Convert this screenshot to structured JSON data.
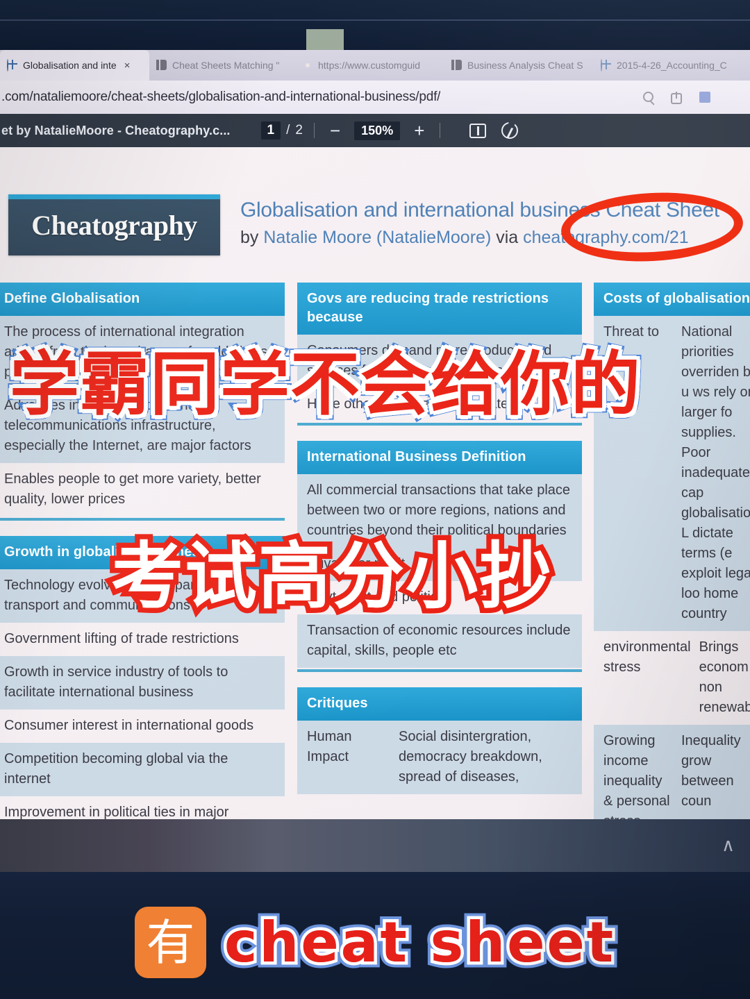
{
  "browser": {
    "tabs": [
      {
        "favicon": "globe-icon",
        "label": "Globalisation and inte",
        "active": true,
        "close": "×"
      },
      {
        "favicon": "book-icon",
        "label": "Cheat Sheets Matching \"",
        "active": false,
        "close": ""
      },
      {
        "favicon": "orange-dot-icon",
        "label": "https://www.customguid",
        "active": false,
        "close": ""
      },
      {
        "favicon": "book-icon",
        "label": "Business Analysis Cheat S",
        "active": false,
        "close": ""
      },
      {
        "favicon": "globe-icon",
        "label": "2015-4-26_Accounting_C",
        "active": false,
        "close": ""
      }
    ],
    "url": ".com/nataliemoore/cheat-sheets/globalisation-and-international-business/pdf/",
    "omni_icons": [
      "search-icon",
      "share-icon",
      "collections-icon",
      "more-icon"
    ]
  },
  "pdf_toolbar": {
    "doc_title": "et by NatalieMoore - Cheatography.c...",
    "page_current": "1",
    "page_separator": "/",
    "page_total": "2",
    "zoom_out": "−",
    "zoom_value": "150%",
    "zoom_in": "+",
    "fit_icon": "fit-page-icon",
    "rotate_icon": "rotate-icon"
  },
  "document": {
    "logo_text": "Cheatography",
    "title": "Globalisation and international business Cheat Sheet",
    "byline_prefix": "by ",
    "author": "Natalie Moore (NatalieMoore)",
    "byline_via": " via ",
    "source": "cheatography.com/21",
    "columns": [
      {
        "cards": [
          {
            "header": "Define Globalisation",
            "rows": [
              {
                "text": "The process of international integration arising from the interchange of world views, products, ideas and other aspects of culture",
                "alt": true
              },
              {
                "text": "Advances in transportation and telecommunications infrastructure, especially the Internet, are major factors",
                "alt": true
              },
              {
                "text": "Enables people to get more variety, better quality, lower prices",
                "alt": false
              }
            ]
          },
          {
            "header": "Growth in globalised business",
            "rows": [
              {
                "text": "Technology evolving and expanding, esp in transport and communications",
                "alt": true
              },
              {
                "text": "Government lifting of trade restrictions",
                "alt": false
              },
              {
                "text": "Growth in service industry of tools to facilitate international business",
                "alt": true
              },
              {
                "text": "Consumer interest in international goods",
                "alt": false
              },
              {
                "text": "Competition becoming global via the internet",
                "alt": true
              },
              {
                "text": "Improvement in political ties in major economic",
                "alt": false
              }
            ]
          }
        ]
      },
      {
        "cards": [
          {
            "header": "Govs are reducing trade restrictions because",
            "rows": [
              {
                "text": "Consumers demand more products and services from overseas markets",
                "alt": true
              },
              {
                "text": "Hope other countries reciprocate",
                "alt": false
              }
            ]
          },
          {
            "header": "International Business Definition",
            "rows": [
              {
                "text": "All commercial transactions that take place between two or more regions, nations and countries beyond their political boundaries",
                "alt": true
              },
              {
                "text": "Private for profit",
                "alt": true
              },
              {
                "text": "Govt profit and political",
                "alt": false
              },
              {
                "text": "Transaction of economic resources include capital, skills, people etc",
                "alt": true
              }
            ]
          },
          {
            "header": "Critiques",
            "rows": [
              {
                "k": "Human Impact",
                "v": "Social disintergration, democracy breakdown, spread of diseases,",
                "alt": true
              }
            ]
          }
        ]
      },
      {
        "cards": [
          {
            "header": "Costs of globalisation",
            "rows": [
              {
                "k": "Threat to",
                "v": "National priorities overriden by u ws rely on larger fo supplies. Poor inadequate cap globalisation. L dictate terms (e exploit legal loo home country",
                "alt": true
              },
              {
                "k": "environmental stress",
                "v": "Brings econom non renewable",
                "alt": false
              },
              {
                "k": "Growing income inequality & personal stress",
                "v": "Inequality grow between coun",
                "alt": true
              }
            ]
          }
        ]
      }
    ]
  },
  "overlay": {
    "line1": "学霸同学不会给你的",
    "line2": "考试高分小抄",
    "badge": "有",
    "caption": "cheat sheet"
  },
  "footer": {
    "chevron": "∧"
  },
  "colors": {
    "card_header": "#2fa9da",
    "annotation_red": "#f0290d",
    "badge_orange": "#f08033",
    "link_blue": "#4c7fb5",
    "row_alt": "#ccdae6"
  }
}
